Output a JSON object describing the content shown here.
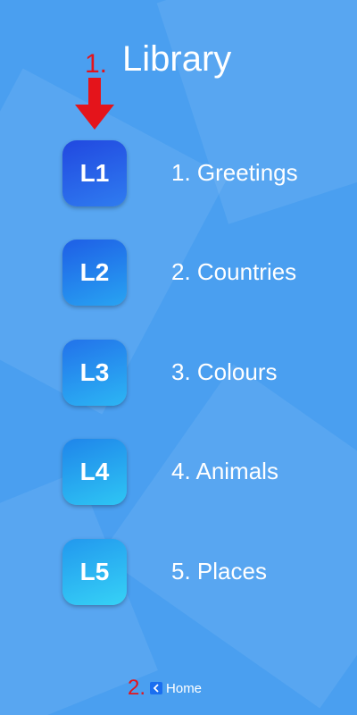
{
  "header": {
    "step_marker": "1.",
    "title": "Library"
  },
  "lessons": [
    {
      "code": "L1",
      "label": "1. Greetings",
      "color_top": "#2148e0",
      "color_bottom": "#2f7cf0"
    },
    {
      "code": "L2",
      "label": "2. Countries",
      "color_top": "#1e5ee6",
      "color_bottom": "#28a4f2"
    },
    {
      "code": "L3",
      "label": "3. Colours",
      "color_top": "#2272ea",
      "color_bottom": "#2cb6f4"
    },
    {
      "code": "L4",
      "label": "4. Animals",
      "color_top": "#1f85ea",
      "color_bottom": "#2ec6f4"
    },
    {
      "code": "L5",
      "label": "5. Places",
      "color_top": "#2298ee",
      "color_bottom": "#36d2f6"
    }
  ],
  "footer": {
    "step_marker": "2.",
    "home_label": "Home"
  },
  "colors": {
    "background": "#4a9ff0",
    "annotation_red": "#e4141b",
    "home_icon_blue": "#1a6ef0"
  }
}
